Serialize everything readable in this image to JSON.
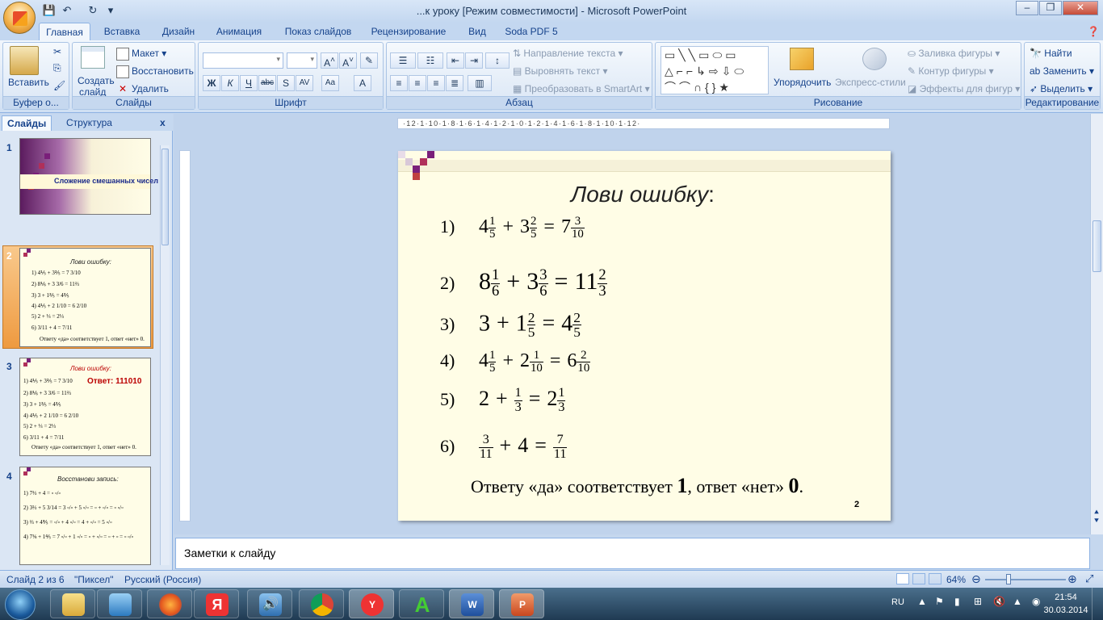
{
  "window": {
    "title": "...к уроку [Режим совместимости] - Microsoft PowerPoint"
  },
  "tabs": [
    "Главная",
    "Вставка",
    "Дизайн",
    "Анимация",
    "Показ слайдов",
    "Рецензирование",
    "Вид",
    "Soda PDF 5"
  ],
  "ribbon": {
    "clipboard": {
      "label": "Буфер о...",
      "paste": "Вставить"
    },
    "slides": {
      "label": "Слайды",
      "new_slide": "Создать",
      "new_slide2": "слайд",
      "layout": "Макет",
      "reset": "Восстановить",
      "delete": "Удалить"
    },
    "font": {
      "label": "Шрифт"
    },
    "paragraph": {
      "label": "Абзац",
      "text_direction": "Направление текста",
      "align_text": "Выровнять текст",
      "smartart": "Преобразовать в SmartArt"
    },
    "drawing": {
      "label": "Рисование",
      "arrange": "Упорядочить",
      "quick_styles": "Экспресс-стили",
      "fill": "Заливка фигуры",
      "outline": "Контур фигуры",
      "effects": "Эффекты для фигур"
    },
    "editing": {
      "label": "Редактирование",
      "find": "Найти",
      "replace": "Заменить",
      "select": "Выделить"
    }
  },
  "pane": {
    "tab_slides": "Слайды",
    "tab_outline": "Структура"
  },
  "thumbs": {
    "t1": {
      "num": "1",
      "title": "Сложение смешанных чисел"
    },
    "t2": {
      "num": "2",
      "title": "Лови ошибку:",
      "foot": "Ответу «да» соответствует  1, ответ «нет» 0."
    },
    "t3": {
      "num": "3",
      "title": "Лови ошибку:",
      "answer": "Ответ: 111010",
      "foot": "Ответу «да» соответствует  1, ответ «нет» 0."
    },
    "t4": {
      "num": "4",
      "title": "Восстанови запись:"
    }
  },
  "slide": {
    "title": "Лови ошибку",
    "title_colon": ":",
    "items": [
      {
        "n": "1)",
        "a": "4",
        "an": "1",
        "ad": "5",
        "op": "+",
        "b": "3",
        "bn": "2",
        "bd": "5",
        "r": "7",
        "rn": "3",
        "rd": "10"
      },
      {
        "n": "2)",
        "a": "8",
        "an": "1",
        "ad": "6",
        "op": "+",
        "b": "3",
        "bn": "3",
        "bd": "6",
        "r": "11",
        "rn": "2",
        "rd": "3"
      },
      {
        "n": "3)",
        "a": "3",
        "an": "",
        "ad": "",
        "op": "+",
        "b": "1",
        "bn": "2",
        "bd": "5",
        "r": "4",
        "rn": "2",
        "rd": "5"
      },
      {
        "n": "4)",
        "a": "4",
        "an": "1",
        "ad": "5",
        "op": "+",
        "b": "2",
        "bn": "1",
        "bd": "10",
        "r": "6",
        "rn": "2",
        "rd": "10"
      },
      {
        "n": "5)",
        "a": "2",
        "an": "",
        "ad": "",
        "op": "+",
        "b": "",
        "bn": "1",
        "bd": "3",
        "r": "2",
        "rn": "1",
        "rd": "3"
      },
      {
        "n": "6)",
        "a": "",
        "an": "3",
        "ad": "11",
        "op": "+",
        "b": "4",
        "bn": "",
        "bd": "",
        "r": "",
        "rn": "7",
        "rd": "11"
      }
    ],
    "eq": "=",
    "footer_a": "Ответу «да» соответствует",
    "footer_one": "1",
    "footer_b": ", ответ «нет»",
    "footer_zero": "0",
    "footer_end": ".",
    "page": "2"
  },
  "notes": {
    "placeholder": "Заметки к слайду"
  },
  "status": {
    "slide": "Слайд 2 из 6",
    "theme": "\"Пиксел\"",
    "lang": "Русский (Россия)",
    "zoom": "64%"
  },
  "taskbar": {
    "lang": "RU",
    "time": "21:54",
    "date": "30.03.2014"
  },
  "colors": {
    "accent": "#7a1f7a",
    "ribbon": "#dde8f6",
    "slide_bg": "#fffde6"
  }
}
